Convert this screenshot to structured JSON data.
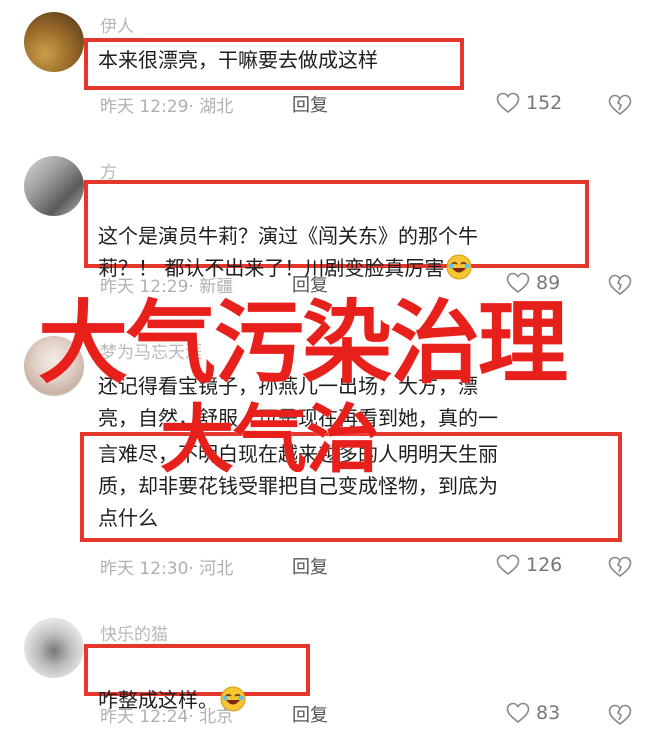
{
  "comments": [
    {
      "username": "伊人",
      "text": "本来很漂亮，干嘛要去做成这样",
      "time": "昨天 12:29",
      "location": "湖北",
      "reply_label": "回复",
      "likes": "152"
    },
    {
      "username": "方",
      "text": "这个是演员牛莉？演过《闯关东》的那个牛\n莉？！ 都认不出来了！川剧变脸真厉害",
      "time": "昨天 12:29",
      "location": "新疆",
      "reply_label": "回复",
      "likes": "89"
    },
    {
      "username": "梦为马忘天涯",
      "text_top": "还记得看宝镜子，孙燕儿一出场，大方，漂\n亮，自然，舒服，可是现在再看到她，真的一",
      "text": "言难尽，不明白现在越来越多的人明明天生丽\n质，却非要花钱受罪把自己变成怪物，到底为\n点什么",
      "time": "昨天 12:30",
      "location": "河北",
      "reply_label": "回复",
      "likes": "126"
    },
    {
      "username": "快乐的猫",
      "text": "咋整成这样。",
      "time": "昨天 12:24",
      "location": "北京",
      "reply_label": "回复",
      "likes": "83"
    }
  ],
  "overlay": {
    "line1": "大气污染治理",
    "line2": "大气治"
  },
  "colors": {
    "highlight_box": "#e6372d",
    "overlay_text": "#e8201c"
  },
  "icons": [
    "heart-icon",
    "dislike-heart-icon",
    "laughing-emoji"
  ]
}
